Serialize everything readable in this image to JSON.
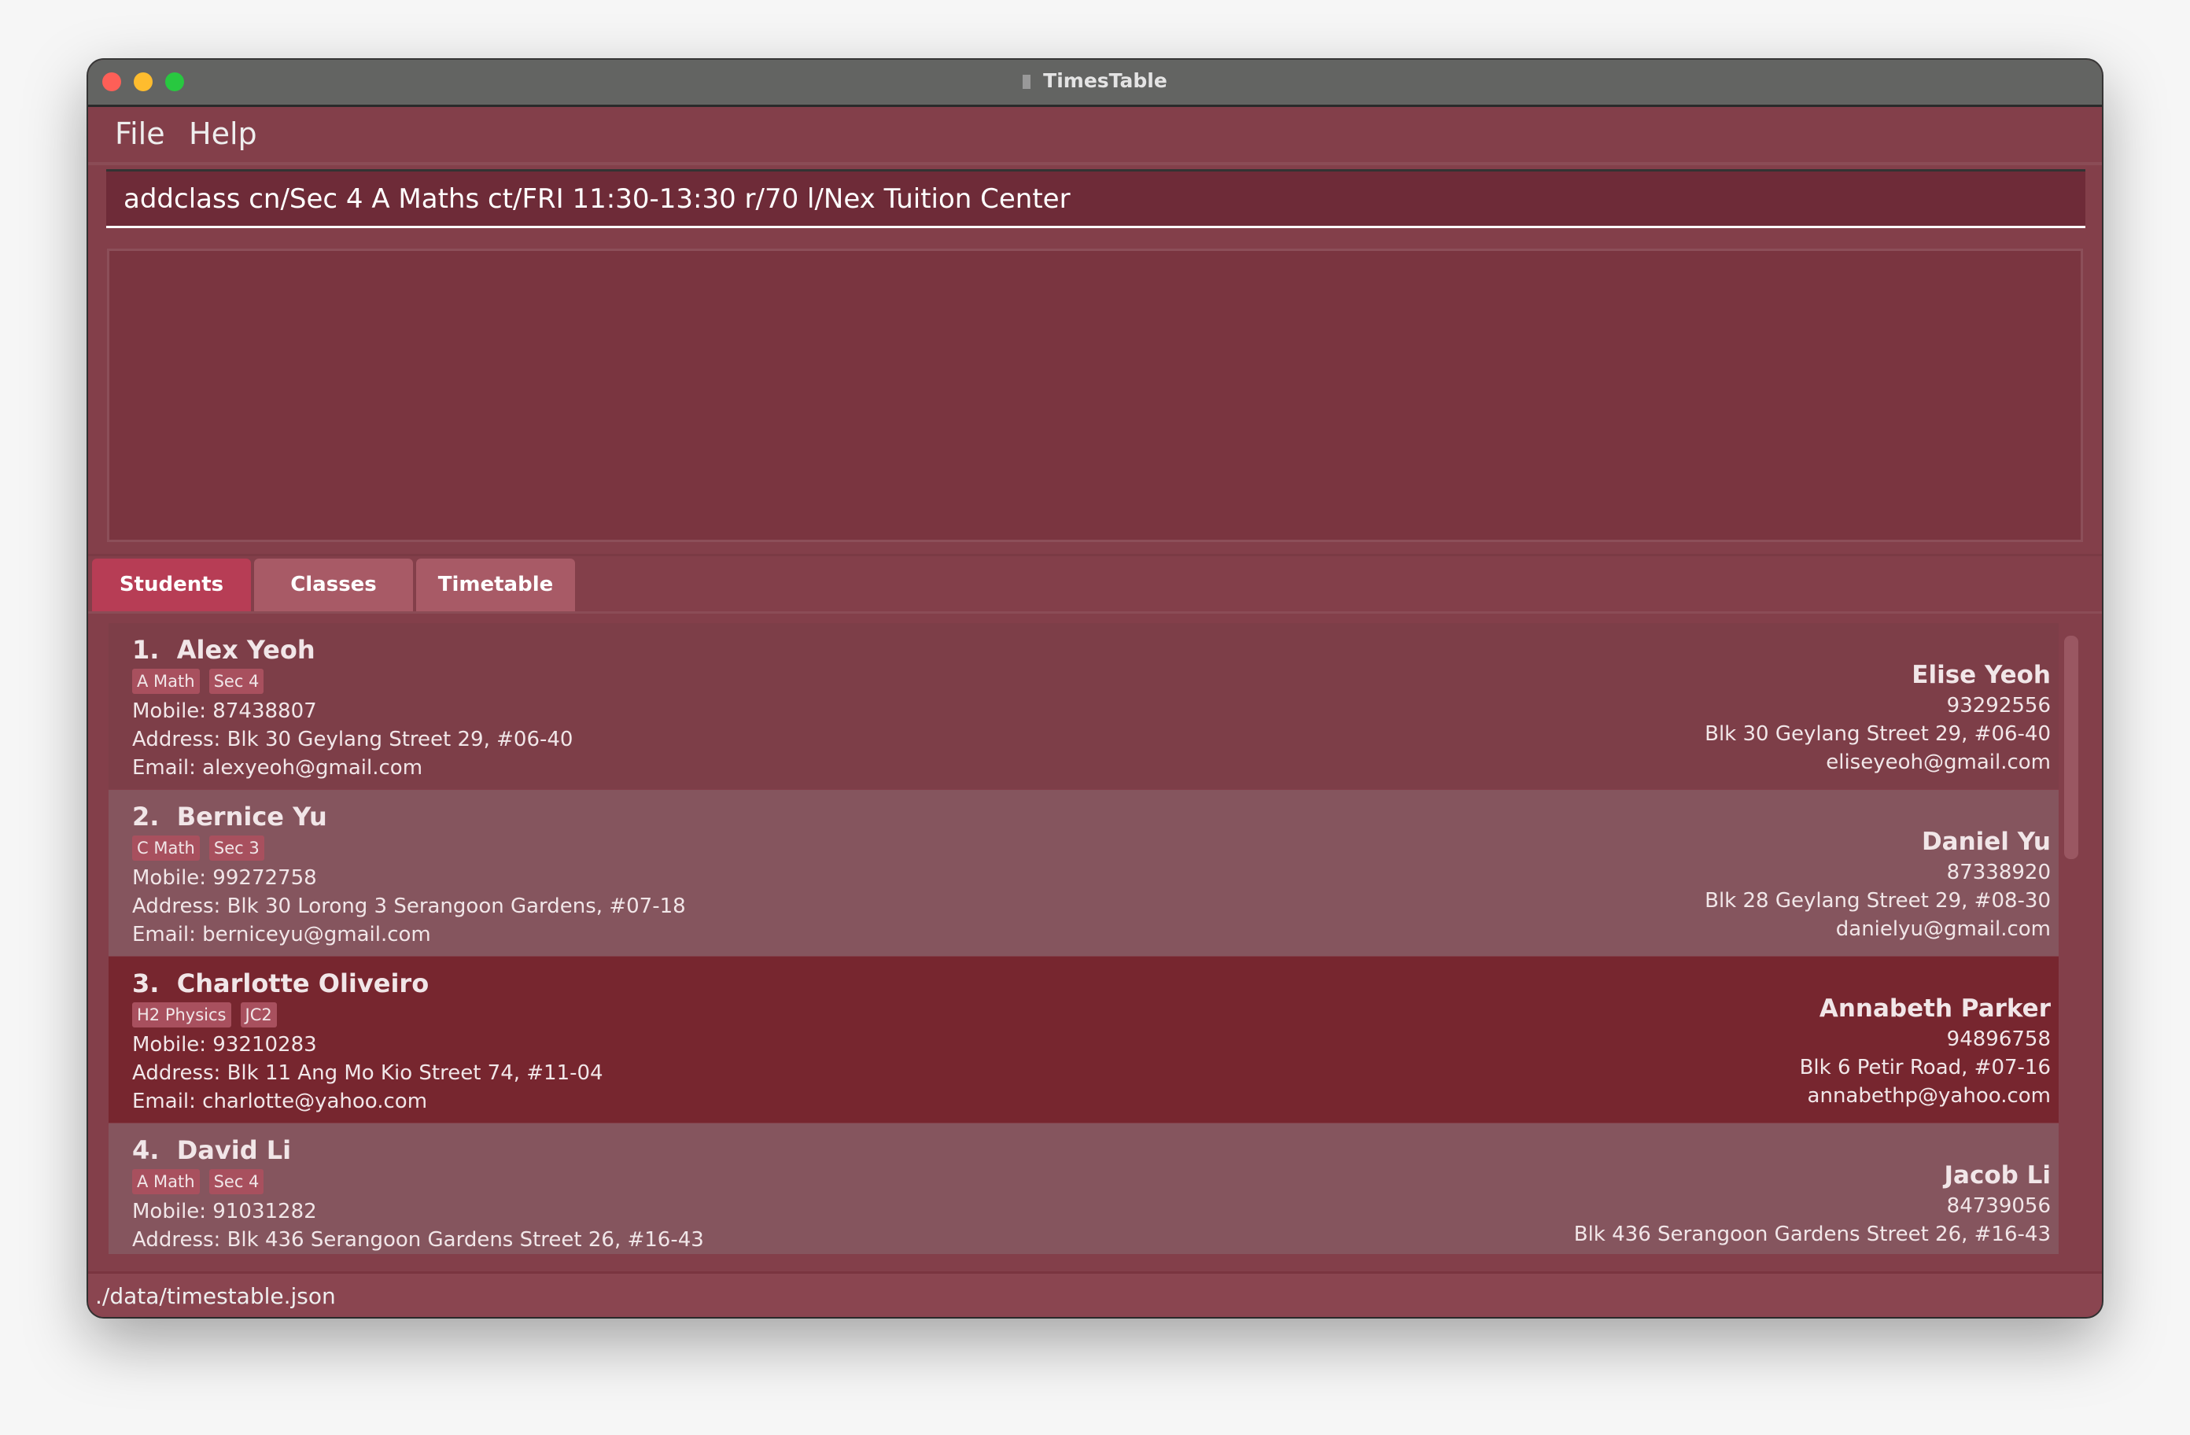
{
  "window": {
    "title": "TimesTable",
    "app_icon": "timestable-app-icon"
  },
  "menu": {
    "items": [
      "File",
      "Help"
    ]
  },
  "command_box": {
    "value": "addclass cn/Sec 4 A Maths ct/FRI 11:30-13:30 r/70 l/Nex Tuition Center",
    "placeholder": ""
  },
  "result_display": {
    "text": ""
  },
  "tabs": [
    {
      "label": "Students",
      "active": true
    },
    {
      "label": "Classes",
      "active": false
    },
    {
      "label": "Timetable",
      "active": false
    }
  ],
  "students": [
    {
      "index": "1.",
      "name": "Alex Yeoh",
      "tags": [
        "A Math",
        "Sec 4"
      ],
      "mobile": "Mobile: 87438807",
      "address": "Address: Blk 30 Geylang Street 29, #06-40",
      "email": "Email: alexyeoh@gmail.com",
      "guardian": {
        "name": "Elise Yeoh",
        "phone": "93292556",
        "address": "Blk 30 Geylang Street 29, #06-40",
        "email": "eliseyeoh@gmail.com"
      }
    },
    {
      "index": "2.",
      "name": "Bernice Yu",
      "tags": [
        "C Math",
        "Sec 3"
      ],
      "mobile": "Mobile: 99272758",
      "address": "Address: Blk 30 Lorong 3 Serangoon Gardens, #07-18",
      "email": "Email: berniceyu@gmail.com",
      "guardian": {
        "name": "Daniel Yu",
        "phone": "87338920",
        "address": "Blk 28 Geylang Street 29, #08-30",
        "email": "danielyu@gmail.com"
      }
    },
    {
      "index": "3.",
      "name": "Charlotte Oliveiro",
      "tags": [
        "H2 Physics",
        "JC2"
      ],
      "mobile": "Mobile: 93210283",
      "address": "Address: Blk 11 Ang Mo Kio Street 74, #11-04",
      "email": "Email: charlotte@yahoo.com",
      "guardian": {
        "name": "Annabeth Parker",
        "phone": "94896758",
        "address": "Blk 6 Petir Road, #07-16",
        "email": "annabethp@yahoo.com"
      },
      "selected": true
    },
    {
      "index": "4.",
      "name": "David Li",
      "tags": [
        "A Math",
        "Sec 4"
      ],
      "mobile": "Mobile: 91031282",
      "address": "Address: Blk 436 Serangoon Gardens Street 26, #16-43",
      "email": "",
      "guardian": {
        "name": "Jacob Li",
        "phone": "84739056",
        "address": "Blk 436 Serangoon Gardens Street 26, #16-43",
        "email": ""
      }
    }
  ],
  "status_bar": {
    "path": "./data/timestable.json"
  },
  "colors": {
    "window_bg": "#833f4a",
    "title_bar": "#636462",
    "active_tab": "#b73d55",
    "tab": "#a85a66",
    "card_odd": "#7d3e48",
    "card_even": "#85555e",
    "card_selected": "#77262f",
    "tag": "#a8505e"
  }
}
